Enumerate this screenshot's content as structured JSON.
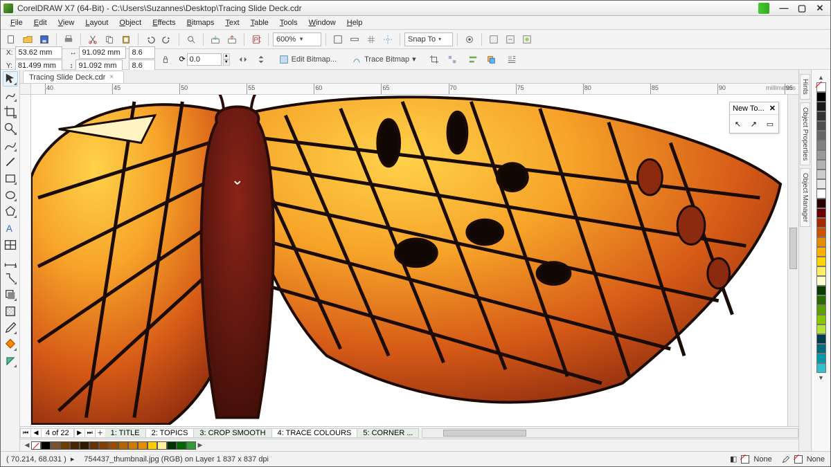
{
  "title": "CorelDRAW X7 (64-Bit) - C:\\Users\\Suzannes\\Desktop\\Tracing Slide Deck.cdr",
  "menu": [
    "File",
    "Edit",
    "View",
    "Layout",
    "Object",
    "Effects",
    "Bitmaps",
    "Text",
    "Table",
    "Tools",
    "Window",
    "Help"
  ],
  "zoom": "600%",
  "snap": "Snap To",
  "pos": {
    "x_label": "X:",
    "x": "53.62 mm",
    "y_label": "Y:",
    "y": "81.499 mm"
  },
  "size": {
    "w": "91.092 mm",
    "h": "91.092 mm"
  },
  "scale": {
    "sx": "8.6",
    "sy": "8.6"
  },
  "rotation": "0.0",
  "edit_bitmap": "Edit Bitmap...",
  "trace_bitmap": "Trace Bitmap",
  "doc_tab": "Tracing Slide Deck.cdr",
  "ruler_unit": "millimeters",
  "ruler_ticks": [
    "40",
    "45",
    "50",
    "55",
    "60",
    "65",
    "70",
    "75",
    "80",
    "85",
    "90",
    "95"
  ],
  "float_title": "New To...",
  "right_tabs": [
    "Hints",
    "Object Properties",
    "Object Manager"
  ],
  "page_nav": {
    "count_label": "4 of 22"
  },
  "page_tabs": [
    "1: TITLE",
    "2: TOPICS",
    "3: CROP SMOOTH",
    "4: TRACE COLOURS",
    "5: CORNER ..."
  ],
  "status": {
    "cursor": "( 70.214, 68.031 )",
    "info": "754437_thumbnail.jpg (RGB) on Layer 1 837 x 837 dpi",
    "fill": "None",
    "outline": "None"
  },
  "palette_colors": [
    "#000000",
    "#1a1a1a",
    "#333333",
    "#4d4d4d",
    "#666666",
    "#808080",
    "#999999",
    "#b3b3b3",
    "#cccccc",
    "#e6e6e6",
    "#ffffff",
    "#2b0000",
    "#6b0000",
    "#a62a00",
    "#cc5200",
    "#e68a00",
    "#ffb000",
    "#ffd500",
    "#ffee66",
    "#ffffcc",
    "#0a3d00",
    "#2b6b00",
    "#5ea000",
    "#87c800",
    "#b4e13c",
    "#003d4d",
    "#006b7a",
    "#0099a8",
    "#33c0cc"
  ],
  "bottom_colors": [
    "#000000",
    "#7a5230",
    "#6b3f00",
    "#4a2600",
    "#2e1a00",
    "#663300",
    "#804000",
    "#994d00",
    "#b36600",
    "#cc7a00",
    "#e68a00",
    "#ffcc00",
    "#fff0a0",
    "#003300",
    "#006600",
    "#339933"
  ]
}
